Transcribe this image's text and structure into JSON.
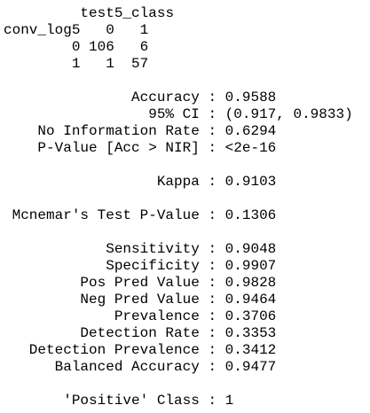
{
  "confusion_matrix": {
    "col_var": "test5_class",
    "row_var": "conv_log5",
    "col_levels": [
      "0",
      "1"
    ],
    "rows": [
      {
        "level": "0",
        "values": [
          "106",
          "6"
        ]
      },
      {
        "level": "1",
        "values": [
          "1",
          "57"
        ]
      }
    ]
  },
  "overall_stats": [
    {
      "label": "Accuracy",
      "value": "0.9588"
    },
    {
      "label": "95% CI",
      "value": "(0.917, 0.9833)"
    },
    {
      "label": "No Information Rate",
      "value": "0.6294"
    },
    {
      "label": "P-Value [Acc > NIR]",
      "value": "<2e-16"
    }
  ],
  "kappa": {
    "label": "Kappa",
    "value": "0.9103"
  },
  "mcnemar": {
    "label": "Mcnemar's Test P-Value",
    "value": "0.1306"
  },
  "class_stats": [
    {
      "label": "Sensitivity",
      "value": "0.9048"
    },
    {
      "label": "Specificity",
      "value": "0.9907"
    },
    {
      "label": "Pos Pred Value",
      "value": "0.9828"
    },
    {
      "label": "Neg Pred Value",
      "value": "0.9464"
    },
    {
      "label": "Prevalence",
      "value": "0.3706"
    },
    {
      "label": "Detection Rate",
      "value": "0.3353"
    },
    {
      "label": "Detection Prevalence",
      "value": "0.3412"
    },
    {
      "label": "Balanced Accuracy",
      "value": "0.9477"
    }
  ],
  "positive_class": {
    "label": "'Positive' Class",
    "value": "1"
  },
  "separator": " : "
}
